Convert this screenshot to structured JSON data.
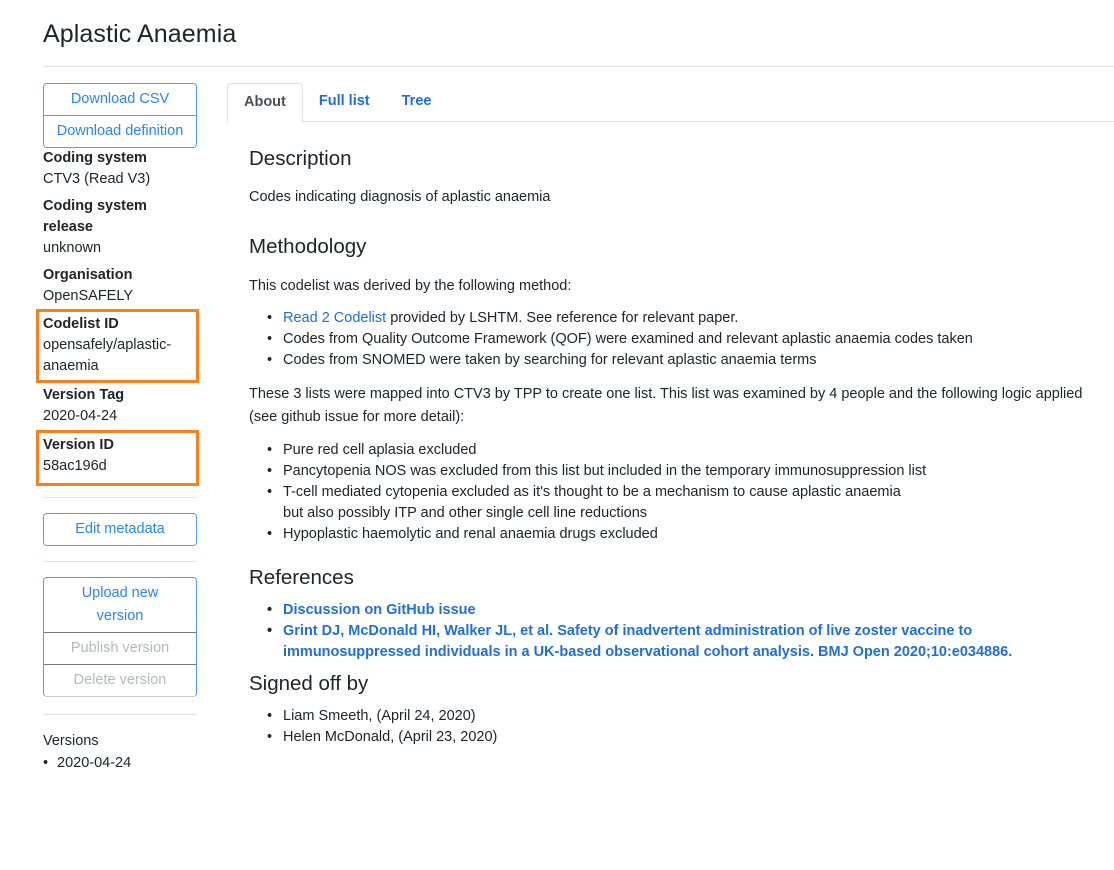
{
  "page": {
    "title": "Aplastic Anaemia"
  },
  "sidebar": {
    "download_buttons": [
      "Download CSV",
      "Download definition"
    ],
    "meta": [
      {
        "label": "Coding system",
        "value": "CTV3 (Read V3)"
      },
      {
        "label": "Coding system release",
        "value": "unknown"
      },
      {
        "label": "Organisation",
        "value": "OpenSAFELY"
      },
      {
        "label": "Codelist ID",
        "value": "opensafely/aplastic-anaemia",
        "highlighted": true
      },
      {
        "label": "Version Tag",
        "value": "2020-04-24"
      },
      {
        "label": "Version ID",
        "value": "58ac196d",
        "highlighted": true
      }
    ],
    "edit_metadata_label": "Edit metadata",
    "version_actions": {
      "upload": "Upload new version",
      "publish": "Publish version",
      "delete": "Delete version"
    },
    "versions_title": "Versions",
    "versions": [
      "2020-04-24"
    ]
  },
  "tabs": [
    {
      "label": "About",
      "active": true
    },
    {
      "label": "Full list",
      "active": false
    },
    {
      "label": "Tree",
      "active": false
    }
  ],
  "about": {
    "description_heading": "Description",
    "description": "Codes indicating diagnosis of aplastic anaemia",
    "methodology_heading": "Methodology",
    "methodology_intro": "This codelist was derived by the following method:",
    "method_items": [
      {
        "link": "Read 2 Codelist",
        "text": " provided by LSHTM. See reference for relevant paper."
      },
      {
        "text": "Codes from Quality Outcome Framework (QOF) were examined and relevant aplastic anaemia codes taken"
      },
      {
        "text": "Codes from SNOMED were taken by searching for relevant aplastic anaemia terms"
      }
    ],
    "mapping_paragraph": "These 3 lists were mapped into CTV3 by TPP to create one list. This list was examined by 4 people and the following logic applied (see github issue for more detail):",
    "logic_items": [
      "Pure red cell aplasia excluded",
      "Pancytopenia NOS was excluded from this list but included in the temporary immunosuppression list",
      "T-cell mediated cytopenia excluded as it's thought to be a mechanism to cause aplastic anaemia but also possibly ITP and other single cell line reductions",
      "Hypoplastic haemolytic and renal anaemia drugs excluded"
    ],
    "references_heading": "References",
    "references": [
      "Discussion on GitHub issue",
      "Grint DJ, McDonald HI, Walker JL, et al. Safety of inadvertent administration of live zoster vaccine to immunosuppressed individuals in a UK-based observational cohort analysis. BMJ Open 2020;10:e034886."
    ],
    "signoff_heading": "Signed off by",
    "signoffs": [
      "Liam Smeeth, (April 24, 2020)",
      "Helen McDonald, (April 23, 2020)"
    ]
  },
  "colors": {
    "link": "#1f6fd6",
    "button_outline": "#4a9cf5",
    "highlight": "#f5821f",
    "disabled_text": "#b5b8bc"
  }
}
